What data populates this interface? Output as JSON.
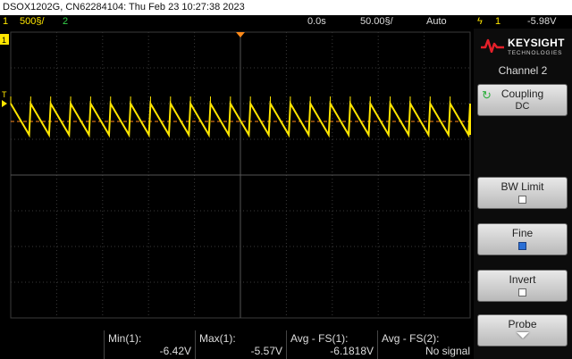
{
  "title_bar": {
    "text": "DSOX1202G, CN62284104: Thu Feb 23 10:27:38 2023"
  },
  "status_bar": {
    "ch1_number": "1",
    "ch1_scale": "500§/",
    "ch2_number": "2",
    "time_offset": "0.0s",
    "time_scale": "50.00§/",
    "trigger_mode": "Auto",
    "trigger_icon": "ϟ",
    "trigger_source": "1",
    "trigger_level": "-5.98V"
  },
  "screen": {
    "ch1_marker": "1",
    "trigger_marker": "T",
    "colors": {
      "ch1": "#ffe600",
      "ch2": "#34d24a",
      "grid": "#3a3a3a",
      "trigger_line": "#ff8a1a"
    },
    "waveform": {
      "type": "sawtooth",
      "periods_visible": 23,
      "high_fraction": 0.5,
      "low_fraction": 0.0
    }
  },
  "panel": {
    "brand": "KEYSIGHT",
    "brand_sub": "TECHNOLOGIES",
    "title": "Channel 2",
    "softkeys": {
      "coupling": {
        "label": "Coupling",
        "value": "DC"
      },
      "bw_limit": {
        "label": "BW Limit",
        "checked": false
      },
      "fine": {
        "label": "Fine",
        "checked": true
      },
      "invert": {
        "label": "Invert",
        "checked": false
      },
      "probe": {
        "label": "Probe"
      }
    }
  },
  "measurements": [
    {
      "name": "Min(1):",
      "value": "-6.42V"
    },
    {
      "name": "Max(1):",
      "value": "-5.57V"
    },
    {
      "name": "Avg - FS(1):",
      "value": "-6.1818V"
    },
    {
      "name": "Avg - FS(2):",
      "value": "No signal"
    }
  ]
}
